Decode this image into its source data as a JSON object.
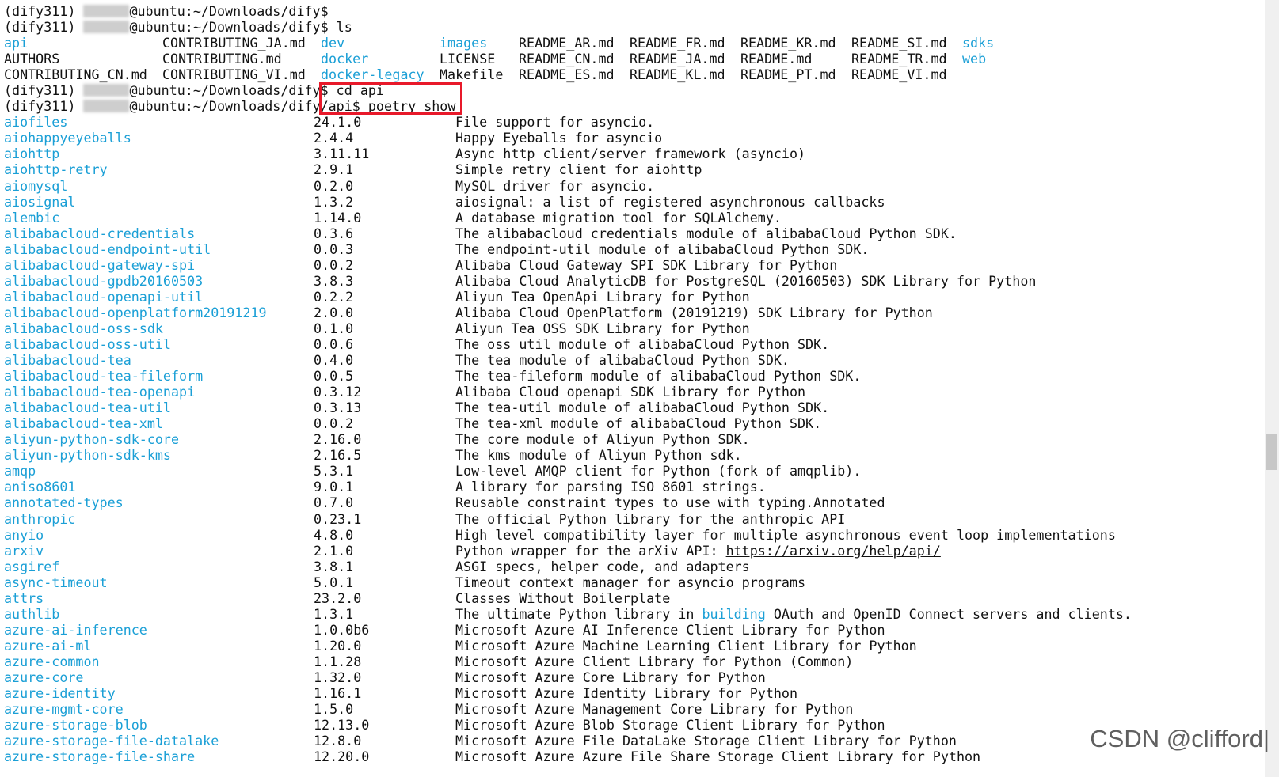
{
  "prompt": {
    "env": "(dify311)",
    "host_suffix": "@ubuntu:~/Downloads/dify$",
    "host_suffix_api_pre": "@ubuntu:~/Downloads/dify",
    "api_path": "/api$"
  },
  "commands": {
    "ls": " ls",
    "cd": " cd api",
    "show": " poetry show"
  },
  "ls_rows": [
    [
      {
        "text": "api",
        "type": "dir"
      },
      {
        "text": "CONTRIBUTING_JA.md",
        "type": "file"
      },
      {
        "text": "dev",
        "type": "dir"
      },
      {
        "text": "images",
        "type": "dir"
      },
      {
        "text": "README_AR.md",
        "type": "file"
      },
      {
        "text": "README_FR.md",
        "type": "file"
      },
      {
        "text": "README_KR.md",
        "type": "file"
      },
      {
        "text": "README_SI.md",
        "type": "file"
      },
      {
        "text": "sdks",
        "type": "dir"
      }
    ],
    [
      {
        "text": "AUTHORS",
        "type": "file"
      },
      {
        "text": "CONTRIBUTING.md",
        "type": "file"
      },
      {
        "text": "docker",
        "type": "dir"
      },
      {
        "text": "LICENSE",
        "type": "file"
      },
      {
        "text": "README_CN.md",
        "type": "file"
      },
      {
        "text": "README_JA.md",
        "type": "file"
      },
      {
        "text": "README.md",
        "type": "file"
      },
      {
        "text": "README_TR.md",
        "type": "file"
      },
      {
        "text": "web",
        "type": "dir"
      }
    ],
    [
      {
        "text": "CONTRIBUTING_CN.md",
        "type": "file"
      },
      {
        "text": "CONTRIBUTING_VI.md",
        "type": "file"
      },
      {
        "text": "docker-legacy",
        "type": "dir"
      },
      {
        "text": "Makefile",
        "type": "file"
      },
      {
        "text": "README_ES.md",
        "type": "file"
      },
      {
        "text": "README_KL.md",
        "type": "file"
      },
      {
        "text": "README_PT.md",
        "type": "file"
      },
      {
        "text": "README_VI.md",
        "type": "file"
      }
    ]
  ],
  "packages": [
    {
      "name": "aiofiles",
      "version": "24.1.0",
      "description": "File support for asyncio."
    },
    {
      "name": "aiohappyeyeballs",
      "version": "2.4.4",
      "description": "Happy Eyeballs for asyncio"
    },
    {
      "name": "aiohttp",
      "version": "3.11.11",
      "description": "Async http client/server framework (asyncio)"
    },
    {
      "name": "aiohttp-retry",
      "version": "2.9.1",
      "description": "Simple retry client for aiohttp"
    },
    {
      "name": "aiomysql",
      "version": "0.2.0",
      "description": "MySQL driver for asyncio."
    },
    {
      "name": "aiosignal",
      "version": "1.3.2",
      "description": "aiosignal: a list of registered asynchronous callbacks"
    },
    {
      "name": "alembic",
      "version": "1.14.0",
      "description": "A database migration tool for SQLAlchemy."
    },
    {
      "name": "alibabacloud-credentials",
      "version": "0.3.6",
      "description": "The alibabacloud credentials module of alibabaCloud Python SDK."
    },
    {
      "name": "alibabacloud-endpoint-util",
      "version": "0.0.3",
      "description": "The endpoint-util module of alibabaCloud Python SDK."
    },
    {
      "name": "alibabacloud-gateway-spi",
      "version": "0.0.2",
      "description": "Alibaba Cloud Gateway SPI SDK Library for Python"
    },
    {
      "name": "alibabacloud-gpdb20160503",
      "version": "3.8.3",
      "description": "Alibaba Cloud AnalyticDB for PostgreSQL (20160503) SDK Library for Python"
    },
    {
      "name": "alibabacloud-openapi-util",
      "version": "0.2.2",
      "description": "Aliyun Tea OpenApi Library for Python"
    },
    {
      "name": "alibabacloud-openplatform20191219",
      "version": "2.0.0",
      "description": "Alibaba Cloud OpenPlatform (20191219) SDK Library for Python"
    },
    {
      "name": "alibabacloud-oss-sdk",
      "version": "0.1.0",
      "description": "Aliyun Tea OSS SDK Library for Python"
    },
    {
      "name": "alibabacloud-oss-util",
      "version": "0.0.6",
      "description": "The oss util module of alibabaCloud Python SDK."
    },
    {
      "name": "alibabacloud-tea",
      "version": "0.4.0",
      "description": "The tea module of alibabaCloud Python SDK."
    },
    {
      "name": "alibabacloud-tea-fileform",
      "version": "0.0.5",
      "description": "The tea-fileform module of alibabaCloud Python SDK."
    },
    {
      "name": "alibabacloud-tea-openapi",
      "version": "0.3.12",
      "description": "Alibaba Cloud openapi SDK Library for Python"
    },
    {
      "name": "alibabacloud-tea-util",
      "version": "0.3.13",
      "description": "The tea-util module of alibabaCloud Python SDK."
    },
    {
      "name": "alibabacloud-tea-xml",
      "version": "0.0.2",
      "description": "The tea-xml module of alibabaCloud Python SDK."
    },
    {
      "name": "aliyun-python-sdk-core",
      "version": "2.16.0",
      "description": "The core module of Aliyun Python SDK."
    },
    {
      "name": "aliyun-python-sdk-kms",
      "version": "2.16.5",
      "description": "The kms module of Aliyun Python sdk."
    },
    {
      "name": "amqp",
      "version": "5.3.1",
      "description": "Low-level AMQP client for Python (fork of amqplib)."
    },
    {
      "name": "aniso8601",
      "version": "9.0.1",
      "description": "A library for parsing ISO 8601 strings."
    },
    {
      "name": "annotated-types",
      "version": "0.7.0",
      "description": "Reusable constraint types to use with typing.Annotated"
    },
    {
      "name": "anthropic",
      "version": "0.23.1",
      "description": "The official Python library for the anthropic API"
    },
    {
      "name": "anyio",
      "version": "4.8.0",
      "description": "High level compatibility layer for multiple asynchronous event loop implementations"
    },
    {
      "name": "arxiv",
      "version": "2.1.0",
      "description": "Python wrapper for the arXiv API: ",
      "link": "https://arxiv.org/help/api/"
    },
    {
      "name": "asgiref",
      "version": "3.8.1",
      "description": "ASGI specs, helper code, and adapters"
    },
    {
      "name": "async-timeout",
      "version": "5.0.1",
      "description": "Timeout context manager for asyncio programs"
    },
    {
      "name": "attrs",
      "version": "23.2.0",
      "description": "Classes Without Boilerplate"
    },
    {
      "name": "authlib",
      "version": "1.3.1",
      "description": "The ultimate Python library in ",
      "highlight": "building",
      "description_tail": " OAuth and OpenID Connect servers and clients."
    },
    {
      "name": "azure-ai-inference",
      "version": "1.0.0b6",
      "description": "Microsoft Azure AI Inference Client Library for Python"
    },
    {
      "name": "azure-ai-ml",
      "version": "1.20.0",
      "description": "Microsoft Azure Machine Learning Client Library for Python"
    },
    {
      "name": "azure-common",
      "version": "1.1.28",
      "description": "Microsoft Azure Client Library for Python (Common)"
    },
    {
      "name": "azure-core",
      "version": "1.32.0",
      "description": "Microsoft Azure Core Library for Python"
    },
    {
      "name": "azure-identity",
      "version": "1.16.1",
      "description": "Microsoft Azure Identity Library for Python"
    },
    {
      "name": "azure-mgmt-core",
      "version": "1.5.0",
      "description": "Microsoft Azure Management Core Library for Python"
    },
    {
      "name": "azure-storage-blob",
      "version": "12.13.0",
      "description": "Microsoft Azure Blob Storage Client Library for Python"
    },
    {
      "name": "azure-storage-file-datalake",
      "version": "12.8.0",
      "description": "Microsoft Azure File DataLake Storage Client Library for Python"
    },
    {
      "name": "azure-storage-file-share",
      "version": "12.20.0",
      "description": "Microsoft Azure Azure File Share Storage Client Library for Python"
    }
  ],
  "watermark": "CSDN @clifford|",
  "colors": {
    "directory": "#1a9fd6",
    "highlight_box": "#e8192a",
    "background": "#ffffff"
  }
}
